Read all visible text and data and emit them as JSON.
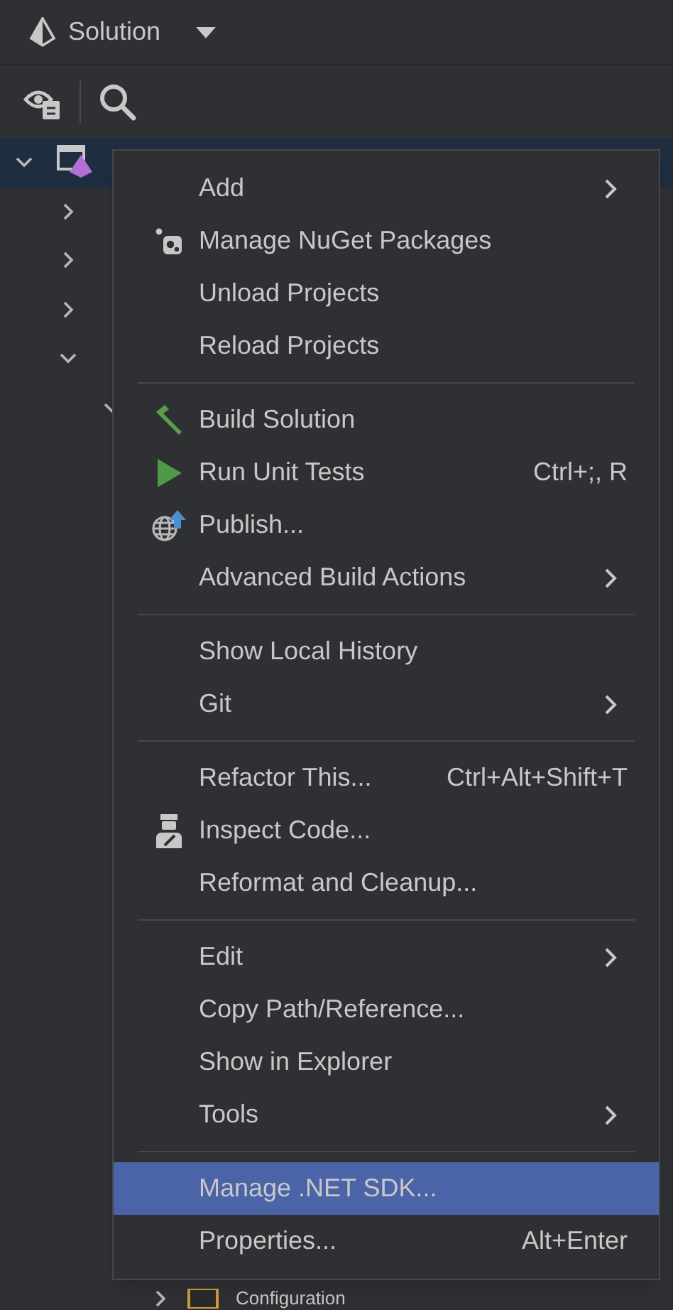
{
  "header": {
    "title": "Solution"
  },
  "tree": [
    {
      "expanded": true,
      "selected": true,
      "children": [
        {
          "expanded": false,
          "selected": false
        },
        {
          "expanded": false,
          "selected": false
        },
        {
          "expanded": false,
          "selected": false
        },
        {
          "expanded": true,
          "selected": false,
          "children": [
            {
              "expanded": true,
              "selected": false
            }
          ]
        }
      ]
    }
  ],
  "bottom_row": {
    "label": "Configuration",
    "expanded": false
  },
  "context_menu": {
    "groups": [
      [
        {
          "label": "Add",
          "kind": "plain",
          "submenu": true,
          "selected": false
        },
        {
          "label": "Manage NuGet Packages",
          "kind": "nuget",
          "submenu": false,
          "selected": false
        },
        {
          "label": "Unload Projects",
          "kind": "plain",
          "submenu": false,
          "selected": false
        },
        {
          "label": "Reload Projects",
          "kind": "plain",
          "submenu": false,
          "selected": false
        }
      ],
      [
        {
          "label": "Build Solution",
          "kind": "build",
          "submenu": false,
          "selected": false
        },
        {
          "label": "Run Unit Tests",
          "kind": "run",
          "shortcut": "Ctrl+;, R",
          "submenu": false,
          "selected": false
        },
        {
          "label": "Publish...",
          "kind": "publish",
          "submenu": false,
          "selected": false
        },
        {
          "label": "Advanced Build Actions",
          "kind": "plain",
          "submenu": true,
          "selected": false
        }
      ],
      [
        {
          "label": "Show Local History",
          "kind": "plain",
          "submenu": false,
          "selected": false
        },
        {
          "label": "Git",
          "kind": "plain",
          "submenu": true,
          "selected": false
        }
      ],
      [
        {
          "label": "Refactor This...",
          "kind": "plain",
          "shortcut": "Ctrl+Alt+Shift+T",
          "submenu": false,
          "selected": false
        },
        {
          "label": "Inspect Code...",
          "kind": "inspect",
          "submenu": false,
          "selected": false
        },
        {
          "label": "Reformat and Cleanup...",
          "kind": "plain",
          "submenu": false,
          "selected": false
        }
      ],
      [
        {
          "label": "Edit",
          "kind": "plain",
          "submenu": true,
          "selected": false
        },
        {
          "label": "Copy Path/Reference...",
          "kind": "plain",
          "submenu": false,
          "selected": false
        },
        {
          "label": "Show in Explorer",
          "kind": "plain",
          "submenu": false,
          "selected": false
        },
        {
          "label": "Tools",
          "kind": "plain",
          "submenu": true,
          "selected": false
        }
      ],
      [
        {
          "label": "Manage .NET SDK...",
          "kind": "plain",
          "submenu": false,
          "selected": true
        },
        {
          "label": "Properties...",
          "kind": "plain",
          "shortcut": "Alt+Enter",
          "submenu": false,
          "selected": false
        }
      ]
    ]
  }
}
